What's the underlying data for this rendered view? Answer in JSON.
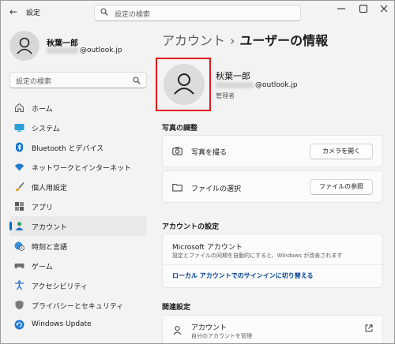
{
  "app": {
    "title": "設定",
    "back_glyph": "←"
  },
  "search": {
    "placeholder": "設定の検索"
  },
  "user": {
    "name": "秋葉一郎",
    "email_suffix": "@outlook.jp",
    "role": "管理者"
  },
  "sidebar": {
    "search_placeholder": "設定の検索",
    "items": [
      {
        "label": "ホーム",
        "icon": "home-icon",
        "selected": false
      },
      {
        "label": "システム",
        "icon": "system-icon",
        "selected": false
      },
      {
        "label": "Bluetooth とデバイス",
        "icon": "bluetooth-icon",
        "selected": false
      },
      {
        "label": "ネットワークとインターネット",
        "icon": "wifi-icon",
        "selected": false
      },
      {
        "label": "個人用設定",
        "icon": "brush-icon",
        "selected": false
      },
      {
        "label": "アプリ",
        "icon": "apps-icon",
        "selected": false
      },
      {
        "label": "アカウント",
        "icon": "accounts-icon",
        "selected": true
      },
      {
        "label": "時刻と言語",
        "icon": "globe-clock-icon",
        "selected": false
      },
      {
        "label": "ゲーム",
        "icon": "gamepad-icon",
        "selected": false
      },
      {
        "label": "アクセシビリティ",
        "icon": "accessibility-icon",
        "selected": false
      },
      {
        "label": "プライバシーとセキュリティ",
        "icon": "shield-icon",
        "selected": false
      },
      {
        "label": "Windows Update",
        "icon": "update-icon",
        "selected": false
      }
    ]
  },
  "breadcrumb": {
    "parent": "アカウント",
    "separator": "›",
    "current": "ユーザーの情報"
  },
  "photo": {
    "section_title": "写真の調整",
    "camera_label": "写真を撮る",
    "camera_button": "カメラを開く",
    "file_label": "ファイルの選択",
    "file_button": "ファイルの参照"
  },
  "account_settings": {
    "section_title": "アカウントの設定",
    "ms_title": "Microsoft アカウント",
    "ms_desc": "設定とファイルの同期を自動的にすると、Windows が改善されます",
    "local_link": "ローカル アカウントでのサインインに切り替える"
  },
  "related": {
    "section_title": "関連設定",
    "item_title": "アカウント",
    "item_desc": "自分のアカウントを管理"
  },
  "colors": {
    "accent": "#0067c0",
    "highlight_border": "#e1191c",
    "link": "#003e92"
  }
}
